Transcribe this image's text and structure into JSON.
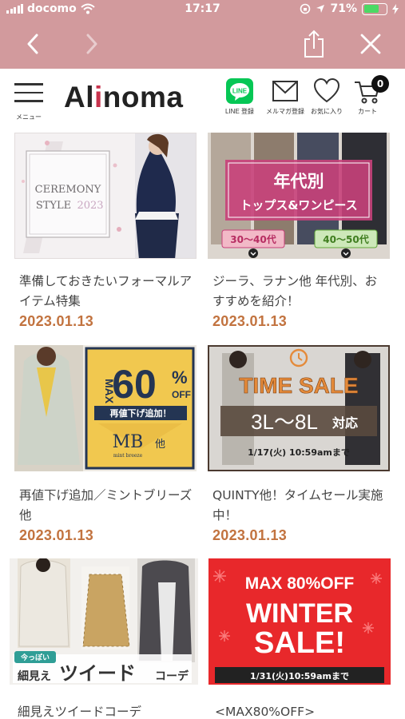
{
  "status_bar": {
    "carrier": "docomo",
    "time": "17:17",
    "battery_percent": "71%",
    "battery_level": 0.71
  },
  "header": {
    "menu_label": "メニュー",
    "logo_prefix": "Al",
    "logo_accent": "i",
    "logo_suffix": "noma",
    "line_icon_text": "LINE",
    "line_label": "LINE 登録",
    "mail_label": "メルマガ登録",
    "favorites_label": "お気に入り",
    "cart_label": "カート",
    "cart_count": "0"
  },
  "articles": [
    {
      "title": "準備しておきたいフォーマルアイテム特集",
      "date": "2023.01.13",
      "banner": {
        "line1": "CEREMONY",
        "line2": "STYLE",
        "year": "2023"
      }
    },
    {
      "title": "ジーラ、ラナン他 年代別、おすすめを紹介！",
      "date": "2023.01.13",
      "banner": {
        "title": "年代別",
        "subtitle": "トップス&ワンピース",
        "tag_left": "30～40代",
        "tag_right": "40～50代"
      }
    },
    {
      "title": "再値下げ追加／ミントブリーズ他",
      "date": "2023.01.13",
      "banner": {
        "max": "MAX",
        "percent": "60",
        "percent_sign": "%",
        "off": "OFF",
        "strip": "再値下げ追加！",
        "brand": "MB",
        "brand_suffix": "他",
        "brand_sub": "mint breeze"
      }
    },
    {
      "title": "QUINTY他！タイムセール実施中！",
      "date": "2023.01.13",
      "banner": {
        "headline": "TIME SALE",
        "sizes": "3L～8L",
        "sizes_suffix": "対応",
        "deadline": "1/17(火) 10:59amまで"
      }
    },
    {
      "title": "細見えツイードコーデ",
      "date": "",
      "banner": {
        "tag": "今っぽい",
        "prefix": "細見え",
        "main": "ツイード",
        "suffix": "コーデ"
      }
    },
    {
      "title": "<MAX80%OFF>",
      "date": "",
      "banner": {
        "line1": "MAX 80%OFF",
        "line2": "WINTER",
        "line3": "SALE!",
        "deadline": "1/31(火)10:59amまで"
      }
    }
  ],
  "colors": {
    "browser_bar": "#d29a9d",
    "logo_accent": "#c8334d",
    "date": "#c2733f",
    "line_green": "#06c755",
    "sale_red": "#e8282b"
  }
}
